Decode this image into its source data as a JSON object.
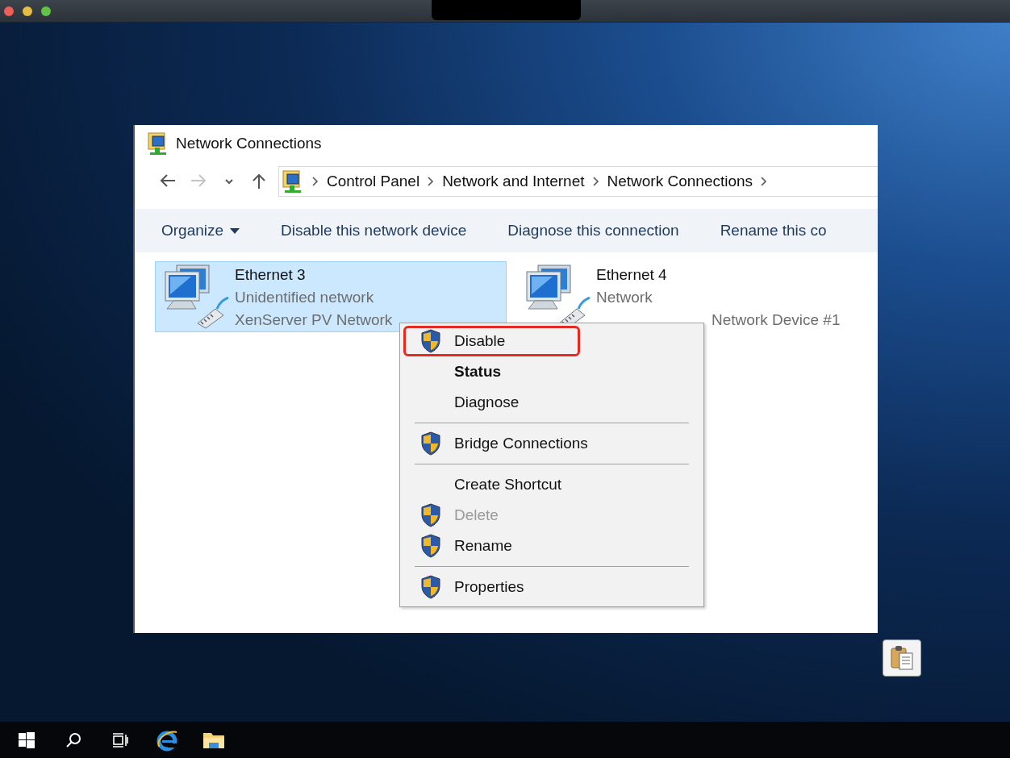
{
  "window": {
    "title": "Network Connections"
  },
  "nav": [
    {
      "kind": "back",
      "disabled": false
    },
    {
      "kind": "forward",
      "disabled": true
    },
    {
      "kind": "recent",
      "disabled": false
    },
    {
      "kind": "up",
      "disabled": false
    }
  ],
  "address_bar": {
    "breadcrumbs": [
      "Control Panel",
      "Network and Internet",
      "Network Connections"
    ]
  },
  "command_bar": [
    {
      "label": "Organize",
      "dropdown": true
    },
    {
      "label": "Disable this network device",
      "dropdown": false
    },
    {
      "label": "Diagnose this connection",
      "dropdown": false
    },
    {
      "label": "Rename this co",
      "dropdown": false
    }
  ],
  "connections": [
    {
      "name": "Ethernet 3",
      "status": "Unidentified network",
      "device": "XenServer PV Network",
      "selected": true
    },
    {
      "name": "Ethernet 4",
      "status": "Network",
      "device": "Network Device #1",
      "selected": false
    }
  ],
  "context_menu": [
    {
      "kind": "item",
      "label": "Disable",
      "shield": true,
      "default": false,
      "disabled": false,
      "highlighted": true
    },
    {
      "kind": "item",
      "label": "Status",
      "shield": false,
      "default": true,
      "disabled": false,
      "highlighted": false
    },
    {
      "kind": "item",
      "label": "Diagnose",
      "shield": false,
      "default": false,
      "disabled": false,
      "highlighted": false
    },
    {
      "kind": "separator"
    },
    {
      "kind": "item",
      "label": "Bridge Connections",
      "shield": true,
      "default": false,
      "disabled": false,
      "highlighted": false
    },
    {
      "kind": "separator"
    },
    {
      "kind": "item",
      "label": "Create Shortcut",
      "shield": false,
      "default": false,
      "disabled": false,
      "highlighted": false
    },
    {
      "kind": "item",
      "label": "Delete",
      "shield": true,
      "default": false,
      "disabled": true,
      "highlighted": false
    },
    {
      "kind": "item",
      "label": "Rename",
      "shield": true,
      "default": false,
      "disabled": false,
      "highlighted": false
    },
    {
      "kind": "separator"
    },
    {
      "kind": "item",
      "label": "Properties",
      "shield": true,
      "default": false,
      "disabled": false,
      "highlighted": false
    }
  ],
  "taskbar": [
    {
      "kind": "start"
    },
    {
      "kind": "search"
    },
    {
      "kind": "taskview"
    },
    {
      "kind": "browser"
    },
    {
      "kind": "folder"
    }
  ]
}
